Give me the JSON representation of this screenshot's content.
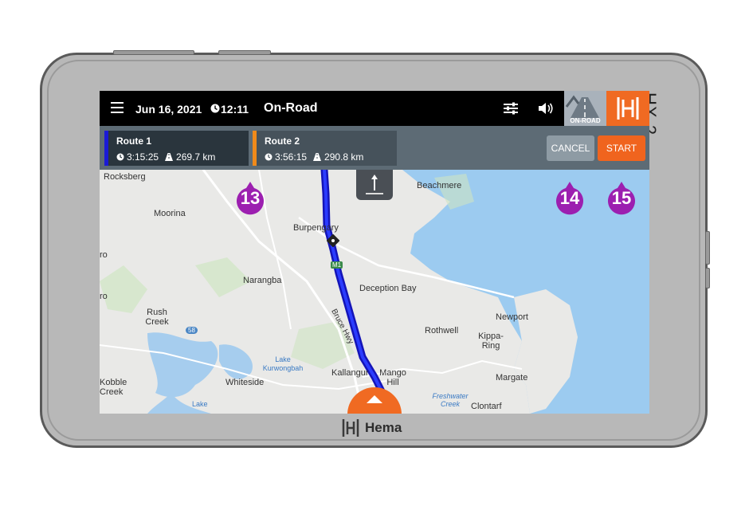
{
  "device": {
    "model": "HX-2",
    "brand": "Hema",
    "brand_color": "#f06a22"
  },
  "topbar": {
    "date": "Jun 16, 2021",
    "time": "12:11",
    "mode": "On-Road",
    "onroad_label": "ON-ROAD",
    "icons": [
      "menu-icon",
      "clock-icon",
      "settings-sliders-icon",
      "volume-icon",
      "hema-logo-icon"
    ]
  },
  "routes": [
    {
      "name": "Route 1",
      "duration": "3:15:25",
      "distance": "269.7 km",
      "color": "#1a1ad6"
    },
    {
      "name": "Route 2",
      "duration": "3:56:15",
      "distance": "290.8 km",
      "color": "#f08a1a"
    }
  ],
  "actions": {
    "cancel_label": "CANCEL",
    "start_label": "START"
  },
  "map": {
    "places": [
      "Rocksberg",
      "Moorina",
      "Burpengary",
      "Beachmere",
      "Narangba",
      "Deception Bay",
      "Rush Creek",
      "Newport",
      "Rothwell",
      "Kippa-Ring",
      "Lake Kurwongbah",
      "Whiteside",
      "Kallangur",
      "Mango Hill",
      "Margate",
      "Kobble Creek",
      "Freshwater Creek",
      "Clontarf",
      "Lake",
      "Bruce Hwy",
      "M1",
      "58",
      "ro",
      "ro"
    ]
  },
  "callouts": [
    "13",
    "14",
    "15"
  ]
}
